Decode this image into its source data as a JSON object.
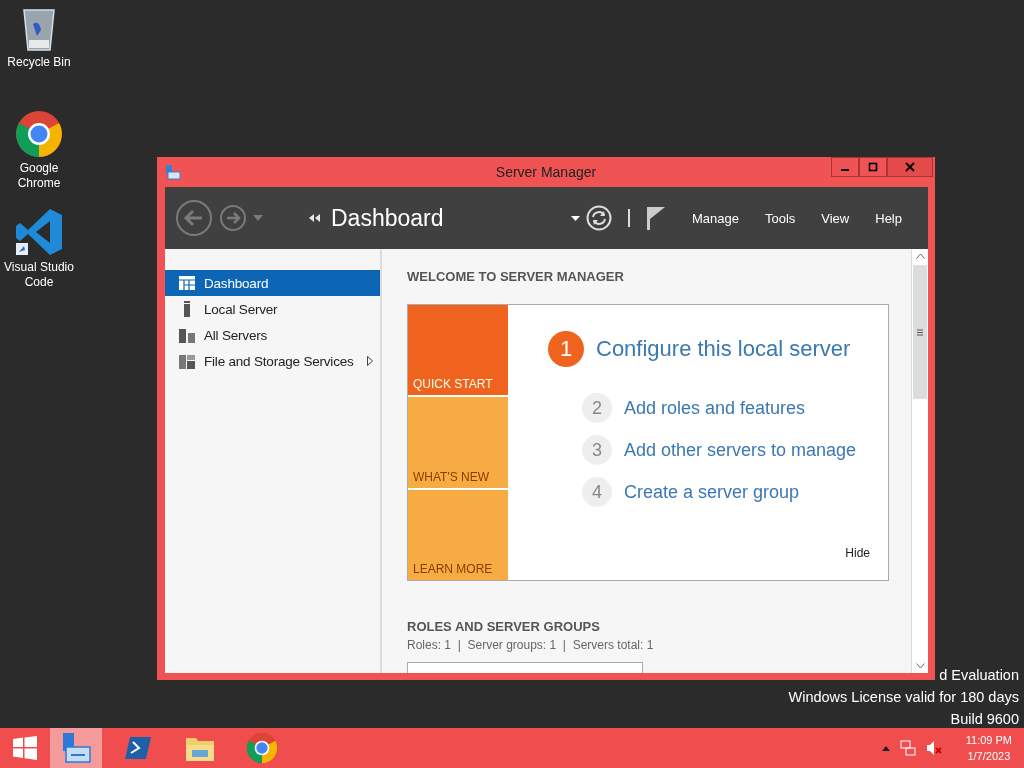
{
  "desktop_icons": [
    {
      "kind": "recycle",
      "label": "Recycle Bin"
    },
    {
      "kind": "chrome",
      "label": "Google Chrome"
    },
    {
      "kind": "vscode",
      "label": "Visual Studio Code"
    }
  ],
  "watermark": [
    "d Evaluation",
    "Windows License valid for 180 days",
    "Build 9600"
  ],
  "window": {
    "title": "Server Manager",
    "breadcrumb": "Dashboard",
    "menu": [
      "Manage",
      "Tools",
      "View",
      "Help"
    ],
    "sidebar": [
      {
        "kind": "dashboard",
        "label": "Dashboard",
        "selected": true,
        "has_submenu": false
      },
      {
        "kind": "server",
        "label": "Local Server",
        "selected": false,
        "has_submenu": false
      },
      {
        "kind": "servers",
        "label": "All Servers",
        "selected": false,
        "has_submenu": false
      },
      {
        "kind": "storage",
        "label": "File and Storage Services",
        "selected": false,
        "has_submenu": true
      }
    ],
    "welcome": {
      "heading": "WELCOME TO SERVER MANAGER",
      "tiles": [
        {
          "label": "QUICK START",
          "selected": true
        },
        {
          "label": "WHAT'S NEW",
          "selected": false
        },
        {
          "label": "LEARN MORE",
          "selected": false
        }
      ],
      "steps": [
        {
          "number": "1",
          "label": "Configure this local server",
          "primary": true
        },
        {
          "number": "2",
          "label": "Add roles and features",
          "primary": false
        },
        {
          "number": "3",
          "label": "Add other servers to manage",
          "primary": false
        },
        {
          "number": "4",
          "label": "Create a server group",
          "primary": false
        }
      ],
      "hide": "Hide"
    },
    "roles": {
      "heading": "ROLES AND SERVER GROUPS",
      "summary": "Roles: 1  |  Server groups: 1  |  Servers total: 1"
    }
  },
  "taskbar": {
    "apps": [
      {
        "kind": "server-manager",
        "selected": true
      },
      {
        "kind": "powershell",
        "selected": false
      },
      {
        "kind": "explorer",
        "selected": false
      },
      {
        "kind": "chrome",
        "selected": false
      }
    ],
    "time": "11:09 PM",
    "date": "1/7/2023"
  }
}
